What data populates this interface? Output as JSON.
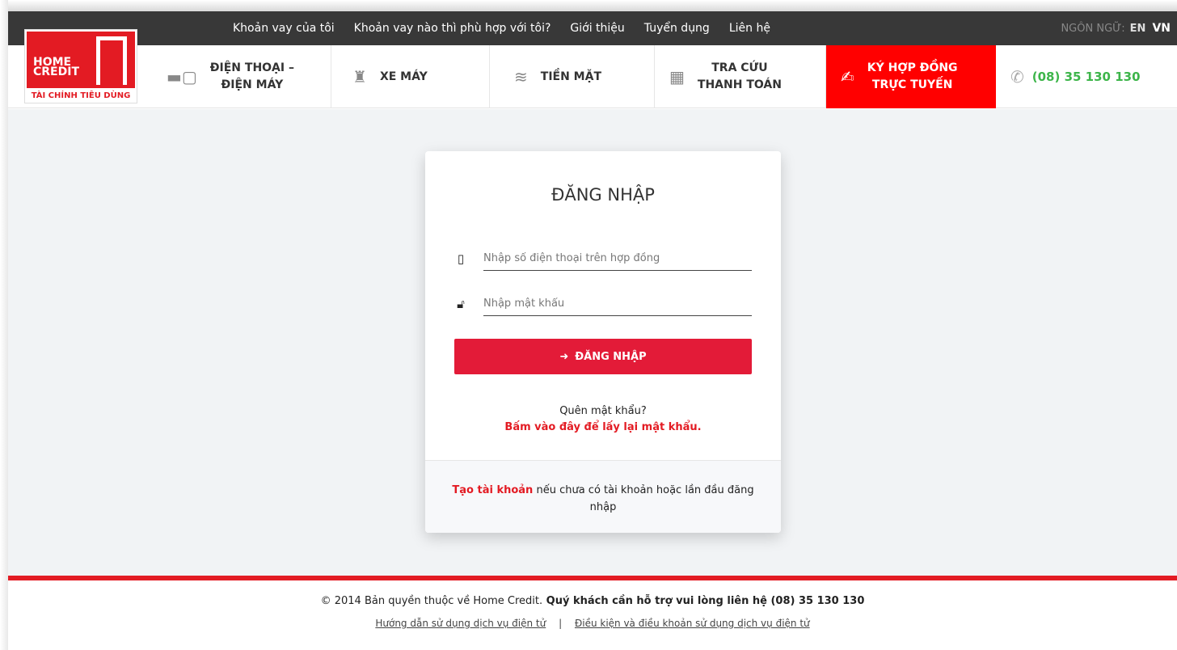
{
  "topnav": {
    "items": [
      "Khoản vay của tôi",
      "Khoản vay nào thì phù hợp với tôi?",
      "Giới thiệu",
      "Tuyển dụng",
      "Liên hệ"
    ],
    "lang_label": "NGÔN NGỮ:",
    "lang_en": "EN",
    "lang_vn": "VN"
  },
  "logo": {
    "text": "HOME CREDIT",
    "subtitle": "TÀI CHÍNH TIÊU DÙNG"
  },
  "mainnav": {
    "phone_devices": "ĐIỆN THOẠI –\nĐIỆN MÁY",
    "motorbike": "XE MÁY",
    "cash": "TIỀN MẶT",
    "payment": "TRA CỨU\nTHANH TOÁN",
    "sign_contract": "KÝ HỢP ĐỒNG\nTRỰC TUYẾN",
    "hotline": "(08) 35 130 130"
  },
  "login": {
    "title": "ĐĂNG NHẬP",
    "phone_placeholder": "Nhập số điện thoại trên hợp đồng",
    "password_placeholder": "Nhập mật khẩu",
    "submit_label": "ĐĂNG NHẬP",
    "forgot_question": "Quên mật khẩu?",
    "forgot_link": "Bấm vào đây để lấy lại mật khẩu.",
    "create_link": "Tạo tài khoản",
    "create_text": " nếu chưa có tài khoản hoặc lần đầu đăng nhập"
  },
  "footer": {
    "copyright": "© 2014 Bản quyền thuộc về Home Credit.",
    "support": " Quý khách cần hỗ trợ vui lòng liên hệ (08) 35 130 130",
    "link_guide": "Hướng dẫn sử dụng dịch vụ điện tử",
    "link_terms": "Điều kiện và điều khoản sử dụng dịch vụ điện tử"
  },
  "colors": {
    "brand_red": "#e31b23",
    "button_red": "#e31b38",
    "hotline_green": "#3db54a",
    "topbar_dark": "#383838"
  }
}
